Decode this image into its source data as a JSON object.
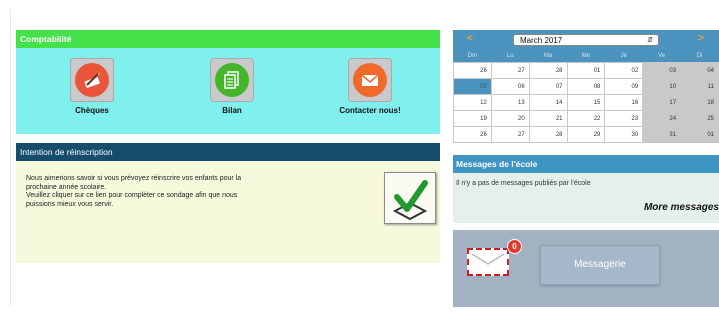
{
  "compta": {
    "title": "Comptabilité",
    "tiles": [
      {
        "label": "Chèques",
        "icon": "pen-check-icon",
        "color": "#e9543a"
      },
      {
        "label": "Bilan",
        "icon": "document-icon",
        "color": "#46b52b"
      },
      {
        "label": "Contacter nous!",
        "icon": "envelope-icon",
        "color": "#ef6a2b"
      }
    ]
  },
  "intent": {
    "title": "Intention de réinscription",
    "lines": [
      "Nous aimerions savoir si vous prévoyez réinscrire vos enfants pour la",
      "prochaine année scolaire.",
      "Veuillez cliquer sur ce lien pour compléter ce sondage afin que nous",
      "puissions mieux vous servir."
    ]
  },
  "calendar": {
    "prev": "<",
    "next": ">",
    "month": "March 2017",
    "weekdays": [
      "Dm",
      "Lu",
      "Ma",
      "Me",
      "Je",
      "Ve",
      "Di"
    ],
    "weeks": [
      [
        "26",
        "27",
        "28",
        "01",
        "02",
        "03",
        "04"
      ],
      [
        "05",
        "06",
        "07",
        "08",
        "09",
        "10",
        "11"
      ],
      [
        "12",
        "13",
        "14",
        "15",
        "16",
        "17",
        "18"
      ],
      [
        "19",
        "20",
        "21",
        "22",
        "23",
        "24",
        "25"
      ],
      [
        "26",
        "27",
        "28",
        "29",
        "30",
        "31",
        "01"
      ]
    ]
  },
  "messages": {
    "title": "Messages de l'école",
    "none": "Il n'y a pas de messages publiés par l'école",
    "more": "More messages"
  },
  "messagerie": {
    "badge": "0",
    "button": "Messagerie"
  }
}
